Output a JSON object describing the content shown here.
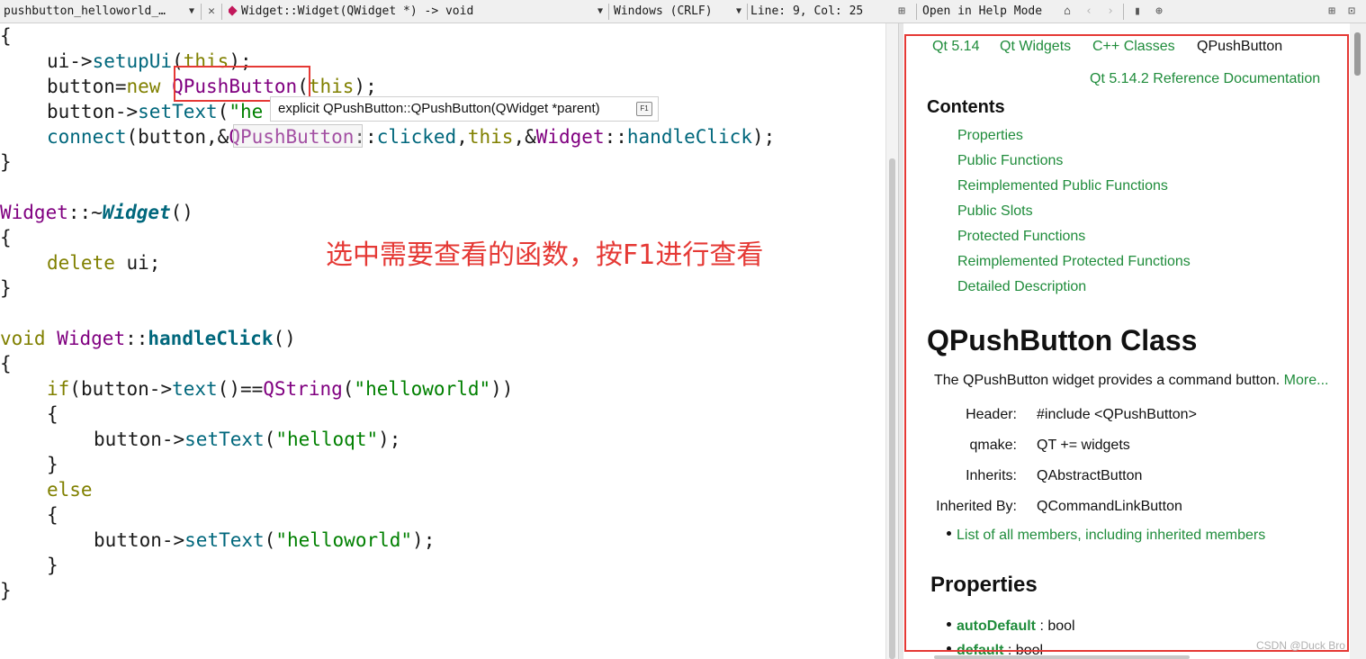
{
  "toolbar": {
    "file_name": "pushbutton_helloworld_…",
    "function_signature": "Widget::Widget(QWidget *) -> void",
    "line_ending": "Windows (CRLF)",
    "cursor_position": "Line: 9, Col: 25",
    "help_mode": "Open in Help Mode"
  },
  "code": {
    "open_brace_1": "{",
    "line_setup": [
      "ui->",
      "setupUi",
      "(",
      "this",
      ");"
    ],
    "line_new": [
      "button=",
      "new",
      " ",
      "QPushButton",
      "(",
      "this",
      ");"
    ],
    "line_settext_prefix": [
      "button->",
      "setText",
      "(",
      "\"he"
    ],
    "line_connect": [
      "connect",
      "(button,&",
      "QPushButton",
      "::",
      "clicked",
      ",",
      "this",
      ",&",
      "Widget",
      "::",
      "handleClick",
      ");"
    ],
    "close_brace_1": "}",
    "dtor": [
      "Widget",
      "::~",
      "Widget",
      "()"
    ],
    "open_brace_2": "{",
    "line_delete": [
      "delete",
      " ui;"
    ],
    "close_brace_2": "}",
    "handler_sig": [
      "void",
      " ",
      "Widget",
      "::",
      "handleClick",
      "()"
    ],
    "open_brace_3": "{",
    "line_if": [
      "if",
      "(button->",
      "text",
      "()==",
      "QString",
      "(",
      "\"helloworld\"",
      "))"
    ],
    "open_brace_4": "{",
    "line_settext_qt": [
      "button->",
      "setText",
      "(",
      "\"helloqt\"",
      ");"
    ],
    "close_brace_4": "}",
    "else_kw": "else",
    "open_brace_5": "{",
    "line_settext_hw": [
      "button->",
      "setText",
      "(",
      "\"helloworld\"",
      ");"
    ],
    "close_brace_5": "}",
    "close_brace_3": "}"
  },
  "tooltip": {
    "text": "explicit QPushButton::QPushButton(QWidget *parent)",
    "key": "F1"
  },
  "annotation": "选中需要查看的函数，按F1进行查看",
  "help": {
    "breadcrumbs": [
      "Qt 5.14",
      "Qt Widgets",
      "C++ Classes"
    ],
    "breadcrumb_current": "QPushButton",
    "ref_doc": "Qt 5.14.2 Reference Documentation",
    "contents_title": "Contents",
    "contents": [
      "Properties",
      "Public Functions",
      "Reimplemented Public Functions",
      "Public Slots",
      "Protected Functions",
      "Reimplemented Protected Functions",
      "Detailed Description"
    ],
    "class_title": "QPushButton Class",
    "brief": "The QPushButton widget provides a command button.",
    "more_link": "More...",
    "header_label": "Header:",
    "header_value": "#include <QPushButton>",
    "qmake_label": "qmake:",
    "qmake_value": "QT += widgets",
    "inherits_label": "Inherits:",
    "inherits_value": "QAbstractButton",
    "inherited_by_label": "Inherited By:",
    "inherited_by_value": "QCommandLinkButton",
    "members_link": "List of all members, including inherited members",
    "properties_title": "Properties",
    "property_1_name": "autoDefault",
    "property_1_type": " : bool",
    "property_2_name": "default",
    "property_2_type": " : bool"
  },
  "watermark": "CSDN @Duck Bro",
  "colors": {
    "keyword": "#808000",
    "type": "#800080",
    "function": "#00677c",
    "string": "#008000",
    "link": "#1f8c3b",
    "highlight_border": "#e53935"
  },
  "icons": [
    "dropdown-icon",
    "close-icon",
    "function-diamond-icon",
    "split-icon",
    "home-icon",
    "back-icon",
    "forward-icon",
    "bookmark-icon",
    "globe-icon",
    "new-window-icon",
    "close-pane-icon"
  ]
}
